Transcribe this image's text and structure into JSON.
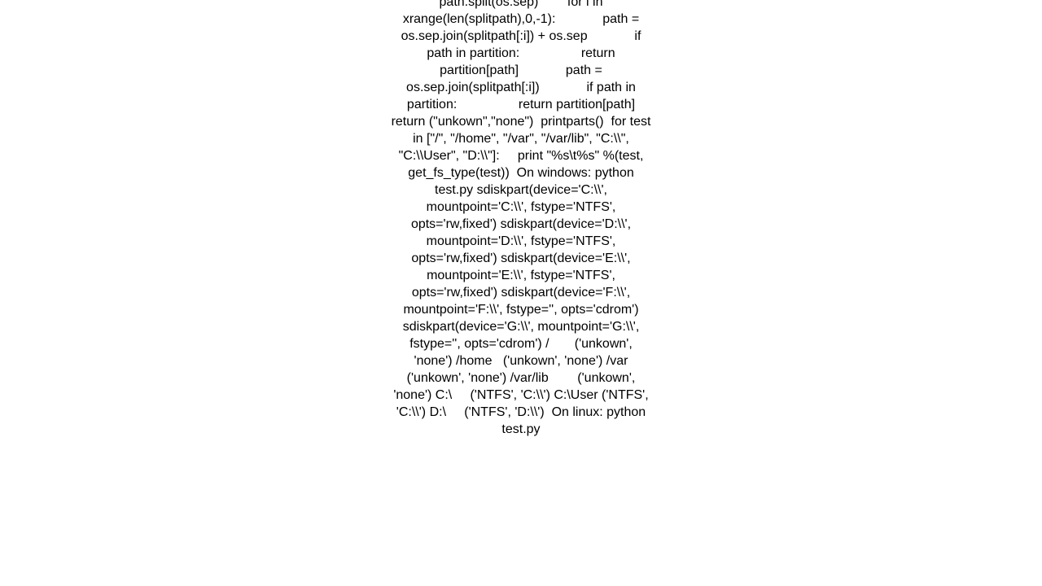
{
  "content": {
    "text": "path.split(os.sep)        for i in xrange(len(splitpath),0,-1):             path = os.sep.join(splitpath[:i]) + os.sep             if path in partition:                 return partition[path]             path = os.sep.join(splitpath[:i])             if path in partition:                 return partition[path]     return (\"unkown\",\"none\")  printparts()  for test in [\"/\", \"/home\", \"/var\", \"/var/lib\", \"C:\\\\\", \"C:\\\\User\", \"D:\\\\\"]:     print \"%s\\t%s\" %(test, get_fs_type(test))  On windows: python test.py sdiskpart(device='C:\\\\', mountpoint='C:\\\\', fstype='NTFS', opts='rw,fixed') sdiskpart(device='D:\\\\', mountpoint='D:\\\\', fstype='NTFS', opts='rw,fixed') sdiskpart(device='E:\\\\', mountpoint='E:\\\\', fstype='NTFS', opts='rw,fixed') sdiskpart(device='F:\\\\', mountpoint='F:\\\\', fstype='', opts='cdrom') sdiskpart(device='G:\\\\', mountpoint='G:\\\\', fstype='', opts='cdrom') /       ('unkown', 'none') /home   ('unkown', 'none') /var    ('unkown', 'none') /var/lib        ('unkown', 'none') C:\\     ('NTFS', 'C:\\\\') C:\\User ('NTFS', 'C:\\\\') D:\\     ('NTFS', 'D:\\\\')  On linux: python test.py"
  }
}
